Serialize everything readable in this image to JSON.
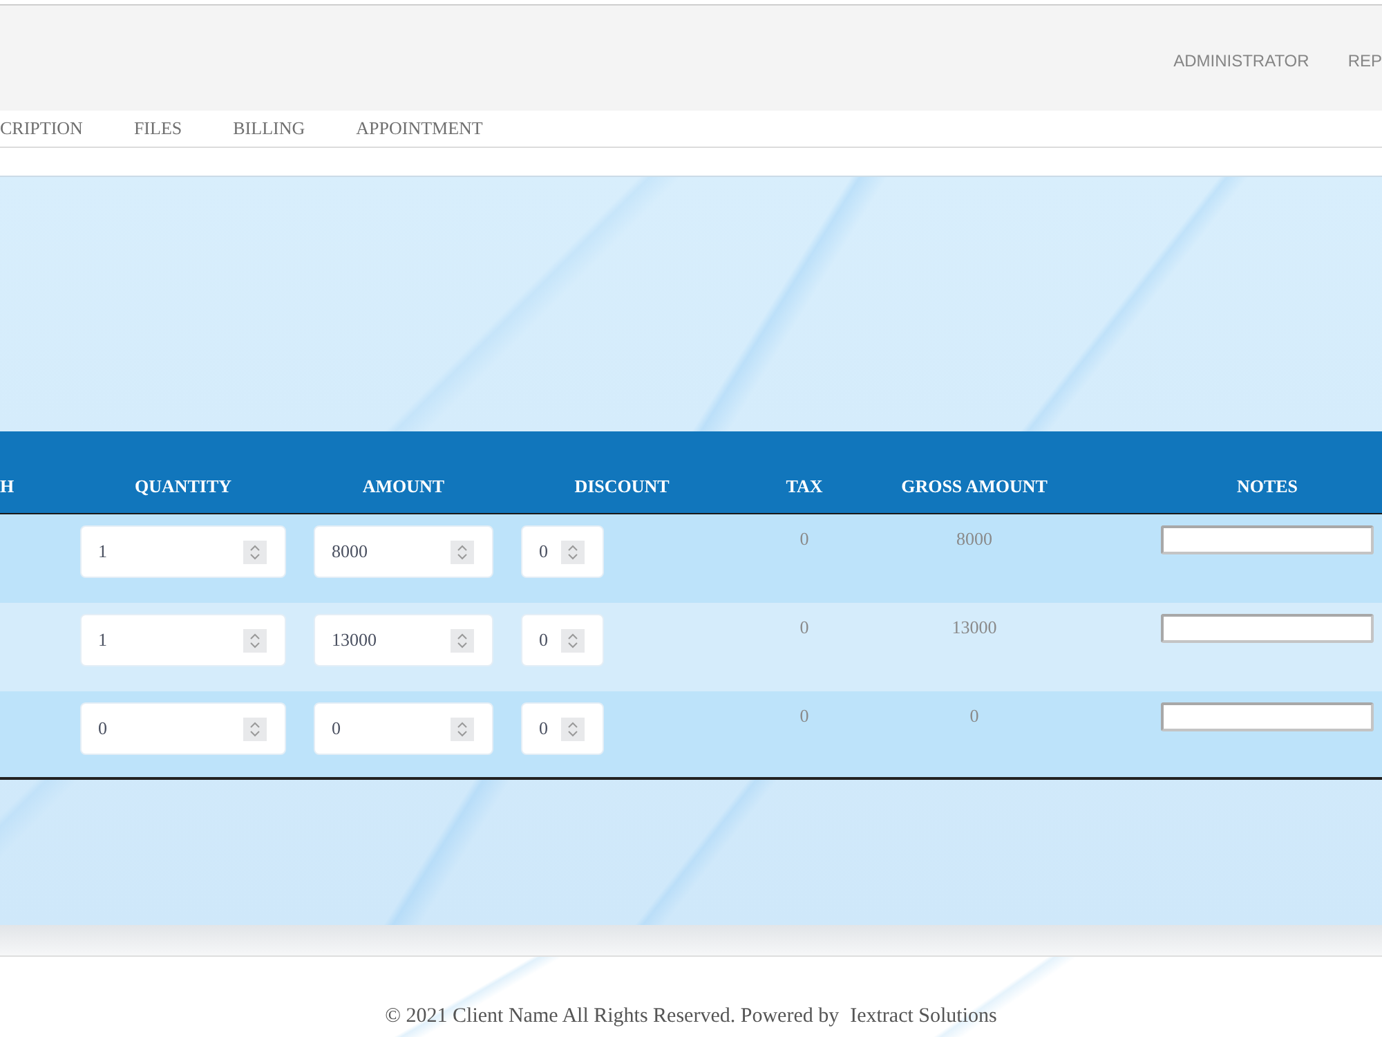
{
  "header": {
    "nav": [
      {
        "label": "ADMINISTRATOR"
      },
      {
        "label": "REP"
      }
    ]
  },
  "tabs": [
    {
      "label": "CRIPTION",
      "selected": false
    },
    {
      "label": "FILES",
      "selected": false
    },
    {
      "label": "BILLING",
      "selected": false
    },
    {
      "label": "APPOINTMENT",
      "selected": false
    }
  ],
  "table": {
    "columns": [
      "H",
      "QUANTITY",
      "AMOUNT",
      "DISCOUNT",
      "TAX",
      "GROSS AMOUNT",
      "NOTES"
    ],
    "rows": [
      {
        "quantity": "1",
        "amount": "8000",
        "discount": "0",
        "tax": "0",
        "gross_amount": "8000"
      },
      {
        "quantity": "1",
        "amount": "13000",
        "discount": "0",
        "tax": "0",
        "gross_amount": "13000"
      },
      {
        "quantity": "0",
        "amount": "0",
        "discount": "0",
        "tax": "0",
        "gross_amount": "0"
      }
    ]
  },
  "footer": {
    "text": "© 2021 Client Name All Rights Reserved. Powered by",
    "link": "Iextract Solutions"
  }
}
